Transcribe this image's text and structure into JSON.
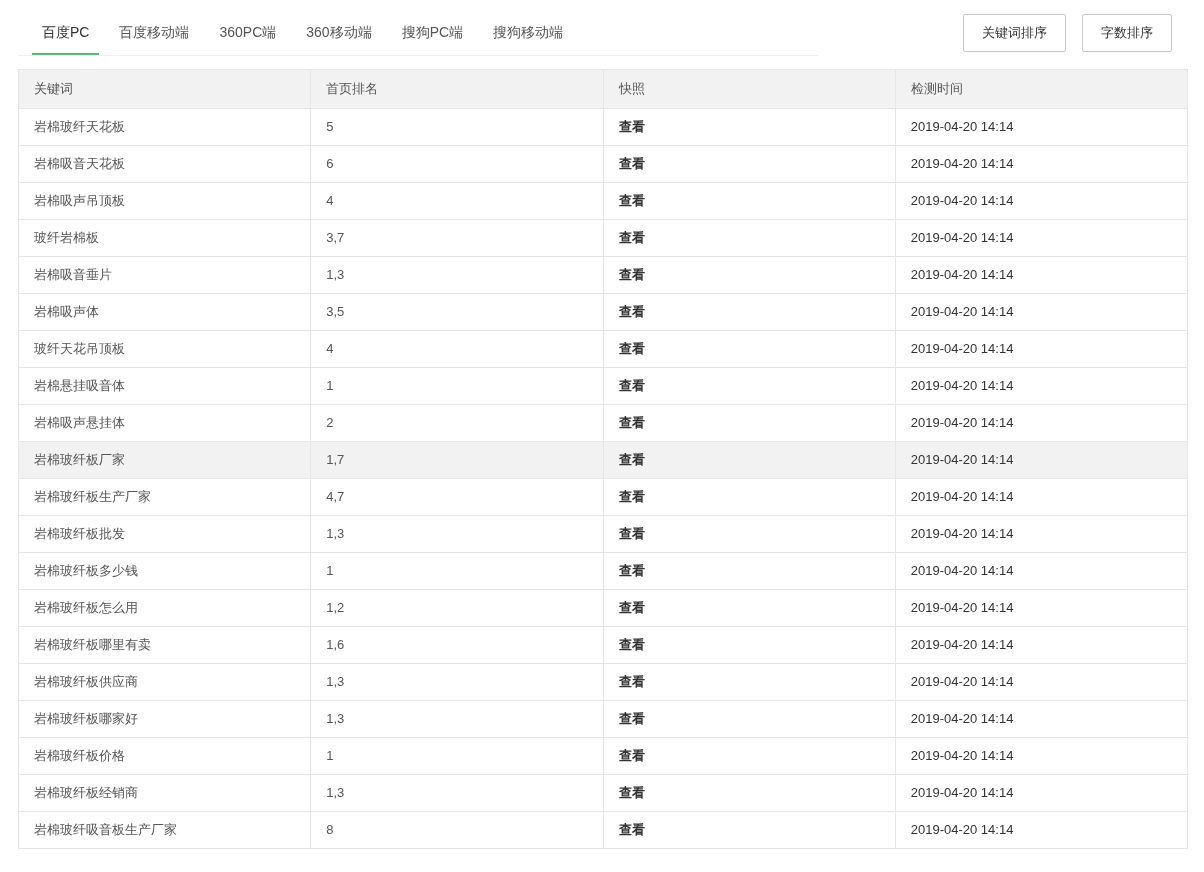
{
  "tabs": [
    {
      "label": "百度PC",
      "selected": true
    },
    {
      "label": "百度移动端",
      "selected": false
    },
    {
      "label": "360PC端",
      "selected": false
    },
    {
      "label": "360移动端",
      "selected": false
    },
    {
      "label": "搜狗PC端",
      "selected": false
    },
    {
      "label": "搜狗移动端",
      "selected": false
    }
  ],
  "buttons": [
    "关键词排序",
    "字数排序"
  ],
  "table": {
    "columns": [
      "关键词",
      "首页排名",
      "快照",
      "检测时间"
    ],
    "rows": [
      {
        "keyword": "岩棉玻纤天花板",
        "rank": "5",
        "snapshot": "查看",
        "time": "2019-04-20 14:14",
        "hovered": false
      },
      {
        "keyword": "岩棉吸音天花板",
        "rank": "6",
        "snapshot": "查看",
        "time": "2019-04-20 14:14",
        "hovered": false
      },
      {
        "keyword": "岩棉吸声吊顶板",
        "rank": "4",
        "snapshot": "查看",
        "time": "2019-04-20 14:14",
        "hovered": false
      },
      {
        "keyword": "玻纤岩棉板",
        "rank": "3,7",
        "snapshot": "查看",
        "time": "2019-04-20 14:14",
        "hovered": false
      },
      {
        "keyword": "岩棉吸音垂片",
        "rank": "1,3",
        "snapshot": "查看",
        "time": "2019-04-20 14:14",
        "hovered": false
      },
      {
        "keyword": "岩棉吸声体",
        "rank": "3,5",
        "snapshot": "查看",
        "time": "2019-04-20 14:14",
        "hovered": false
      },
      {
        "keyword": "玻纤天花吊顶板",
        "rank": "4",
        "snapshot": "查看",
        "time": "2019-04-20 14:14",
        "hovered": false
      },
      {
        "keyword": "岩棉悬挂吸音体",
        "rank": "1",
        "snapshot": "查看",
        "time": "2019-04-20 14:14",
        "hovered": false
      },
      {
        "keyword": "岩棉吸声悬挂体",
        "rank": "2",
        "snapshot": "查看",
        "time": "2019-04-20 14:14",
        "hovered": false
      },
      {
        "keyword": "岩棉玻纤板厂家",
        "rank": "1,7",
        "snapshot": "查看",
        "time": "2019-04-20 14:14",
        "hovered": true
      },
      {
        "keyword": "岩棉玻纤板生产厂家",
        "rank": "4,7",
        "snapshot": "查看",
        "time": "2019-04-20 14:14",
        "hovered": false
      },
      {
        "keyword": "岩棉玻纤板批发",
        "rank": "1,3",
        "snapshot": "查看",
        "time": "2019-04-20 14:14",
        "hovered": false
      },
      {
        "keyword": "岩棉玻纤板多少钱",
        "rank": "1",
        "snapshot": "查看",
        "time": "2019-04-20 14:14",
        "hovered": false
      },
      {
        "keyword": "岩棉玻纤板怎么用",
        "rank": "1,2",
        "snapshot": "查看",
        "time": "2019-04-20 14:14",
        "hovered": false
      },
      {
        "keyword": "岩棉玻纤板哪里有卖",
        "rank": "1,6",
        "snapshot": "查看",
        "time": "2019-04-20 14:14",
        "hovered": false
      },
      {
        "keyword": "岩棉玻纤板供应商",
        "rank": "1,3",
        "snapshot": "查看",
        "time": "2019-04-20 14:14",
        "hovered": false
      },
      {
        "keyword": "岩棉玻纤板哪家好",
        "rank": "1,3",
        "snapshot": "查看",
        "time": "2019-04-20 14:14",
        "hovered": false
      },
      {
        "keyword": "岩棉玻纤板价格",
        "rank": "1",
        "snapshot": "查看",
        "time": "2019-04-20 14:14",
        "hovered": false
      },
      {
        "keyword": "岩棉玻纤板经销商",
        "rank": "1,3",
        "snapshot": "查看",
        "time": "2019-04-20 14:14",
        "hovered": false
      },
      {
        "keyword": "岩棉玻纤吸音板生产厂家",
        "rank": "8",
        "snapshot": "查看",
        "time": "2019-04-20 14:14",
        "hovered": false
      }
    ]
  }
}
